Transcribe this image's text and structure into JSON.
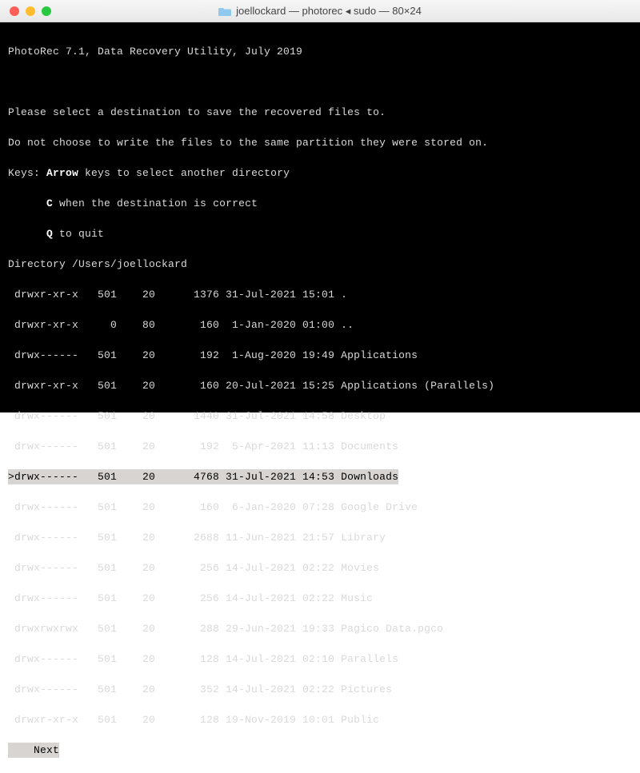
{
  "window": {
    "title": "joellockard — photorec ◂ sudo — 80×24"
  },
  "header": {
    "app": "PhotoRec 7.1, Data Recovery Utility, July 2019",
    "line1": "Please select a destination to save the recovered files to.",
    "line2": "Do not choose to write the files to the same partition they were stored on.",
    "keys_prefix": "Keys: ",
    "keys_arrow": "Arrow",
    "keys_arrow_rest": " keys to select another directory",
    "keys_c": "C",
    "keys_c_rest": " when the destination is correct",
    "keys_q": "Q",
    "keys_q_rest": " to quit",
    "pad6": "      "
  },
  "directory": "Directory /Users/joellockard",
  "rows": [
    " drwxr-xr-x   501    20      1376 31-Jul-2021 15:01 .",
    " drwxr-xr-x     0    80       160  1-Jan-2020 01:00 ..",
    " drwx------   501    20       192  1-Aug-2020 19:49 Applications",
    " drwxr-xr-x   501    20       160 20-Jul-2021 15:25 Applications (Parallels)",
    " drwx------   501    20      1440 31-Jul-2021 14:58 Desktop",
    " drwx------   501    20       192  5-Apr-2021 11:13 Documents",
    " drwx------   501    20       160  6-Jan-2020 07:28 Google Drive",
    " drwx------   501    20      2688 11-Jun-2021 21:57 Library",
    " drwx------   501    20       256 14-Jul-2021 02:22 Movies",
    " drwx------   501    20       256 14-Jul-2021 02:22 Music",
    " drwxrwxrwx   501    20       288 29-Jun-2021 19:33 Pagico Data.pgco",
    " drwx------   501    20       128 14-Jul-2021 02:10 Parallels",
    " drwx------   501    20       352 14-Jul-2021 02:22 Pictures",
    " drwxr-xr-x   501    20       128 19-Nov-2019 10:01 Public"
  ],
  "selected_row": ">drwx------   501    20      4768 31-Jul-2021 14:53 Downloads",
  "footer": "    Next"
}
